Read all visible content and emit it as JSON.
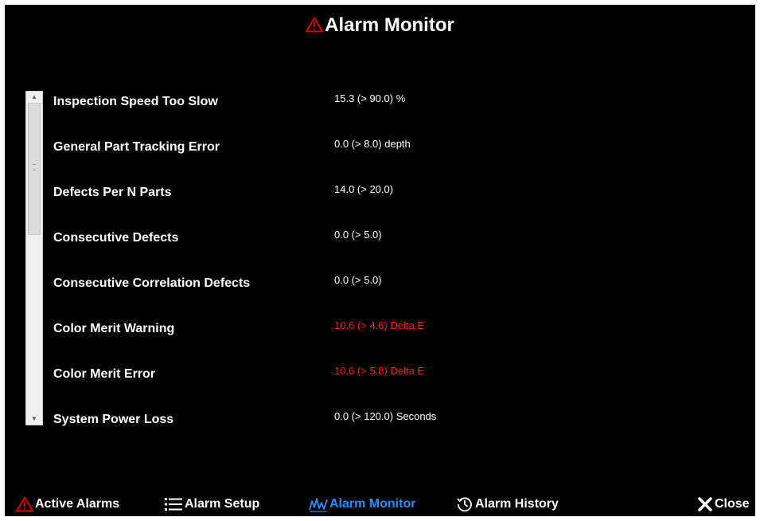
{
  "header": {
    "title": "Alarm Monitor",
    "icon": "warning-icon",
    "icon_color": "#e00000"
  },
  "scrollbar": {
    "position_fraction": 0
  },
  "alarms": [
    {
      "name": "Inspection Speed Too Slow",
      "value": "15.3 (> 90.0) %",
      "alert": false
    },
    {
      "name": "General Part Tracking Error",
      "value": "0.0 (> 8.0) depth",
      "alert": false
    },
    {
      "name": "Defects Per N Parts",
      "value": "14.0 (> 20.0)",
      "alert": false
    },
    {
      "name": "Consecutive Defects",
      "value": "0.0 (> 5.0)",
      "alert": false
    },
    {
      "name": "Consecutive Correlation Defects",
      "value": "0.0 (> 5.0)",
      "alert": false
    },
    {
      "name": "Color Merit Warning",
      "value": "10.6 (> 4.6) Delta E",
      "alert": true
    },
    {
      "name": "Color Merit Error",
      "value": "10.6 (> 5.8) Delta E",
      "alert": true
    },
    {
      "name": "System Power Loss",
      "value": "0.0 (> 120.0) Seconds",
      "alert": false
    }
  ],
  "nav": {
    "active_alarms": {
      "label": "Active Alarms",
      "icon": "warning-icon"
    },
    "alarm_setup": {
      "label": "Alarm Setup",
      "icon": "list-icon"
    },
    "alarm_monitor": {
      "label": "Alarm Monitor",
      "icon": "monitor-chart-icon",
      "active": true
    },
    "alarm_history": {
      "label": "Alarm History",
      "icon": "history-icon"
    },
    "close": {
      "label": "Close",
      "icon": "close-icon"
    }
  },
  "colors": {
    "background": "#000000",
    "text": "#ffffff",
    "alert_text": "#ff1a1a",
    "active_nav": "#1f8fff",
    "warning_icon": "#e00000"
  }
}
